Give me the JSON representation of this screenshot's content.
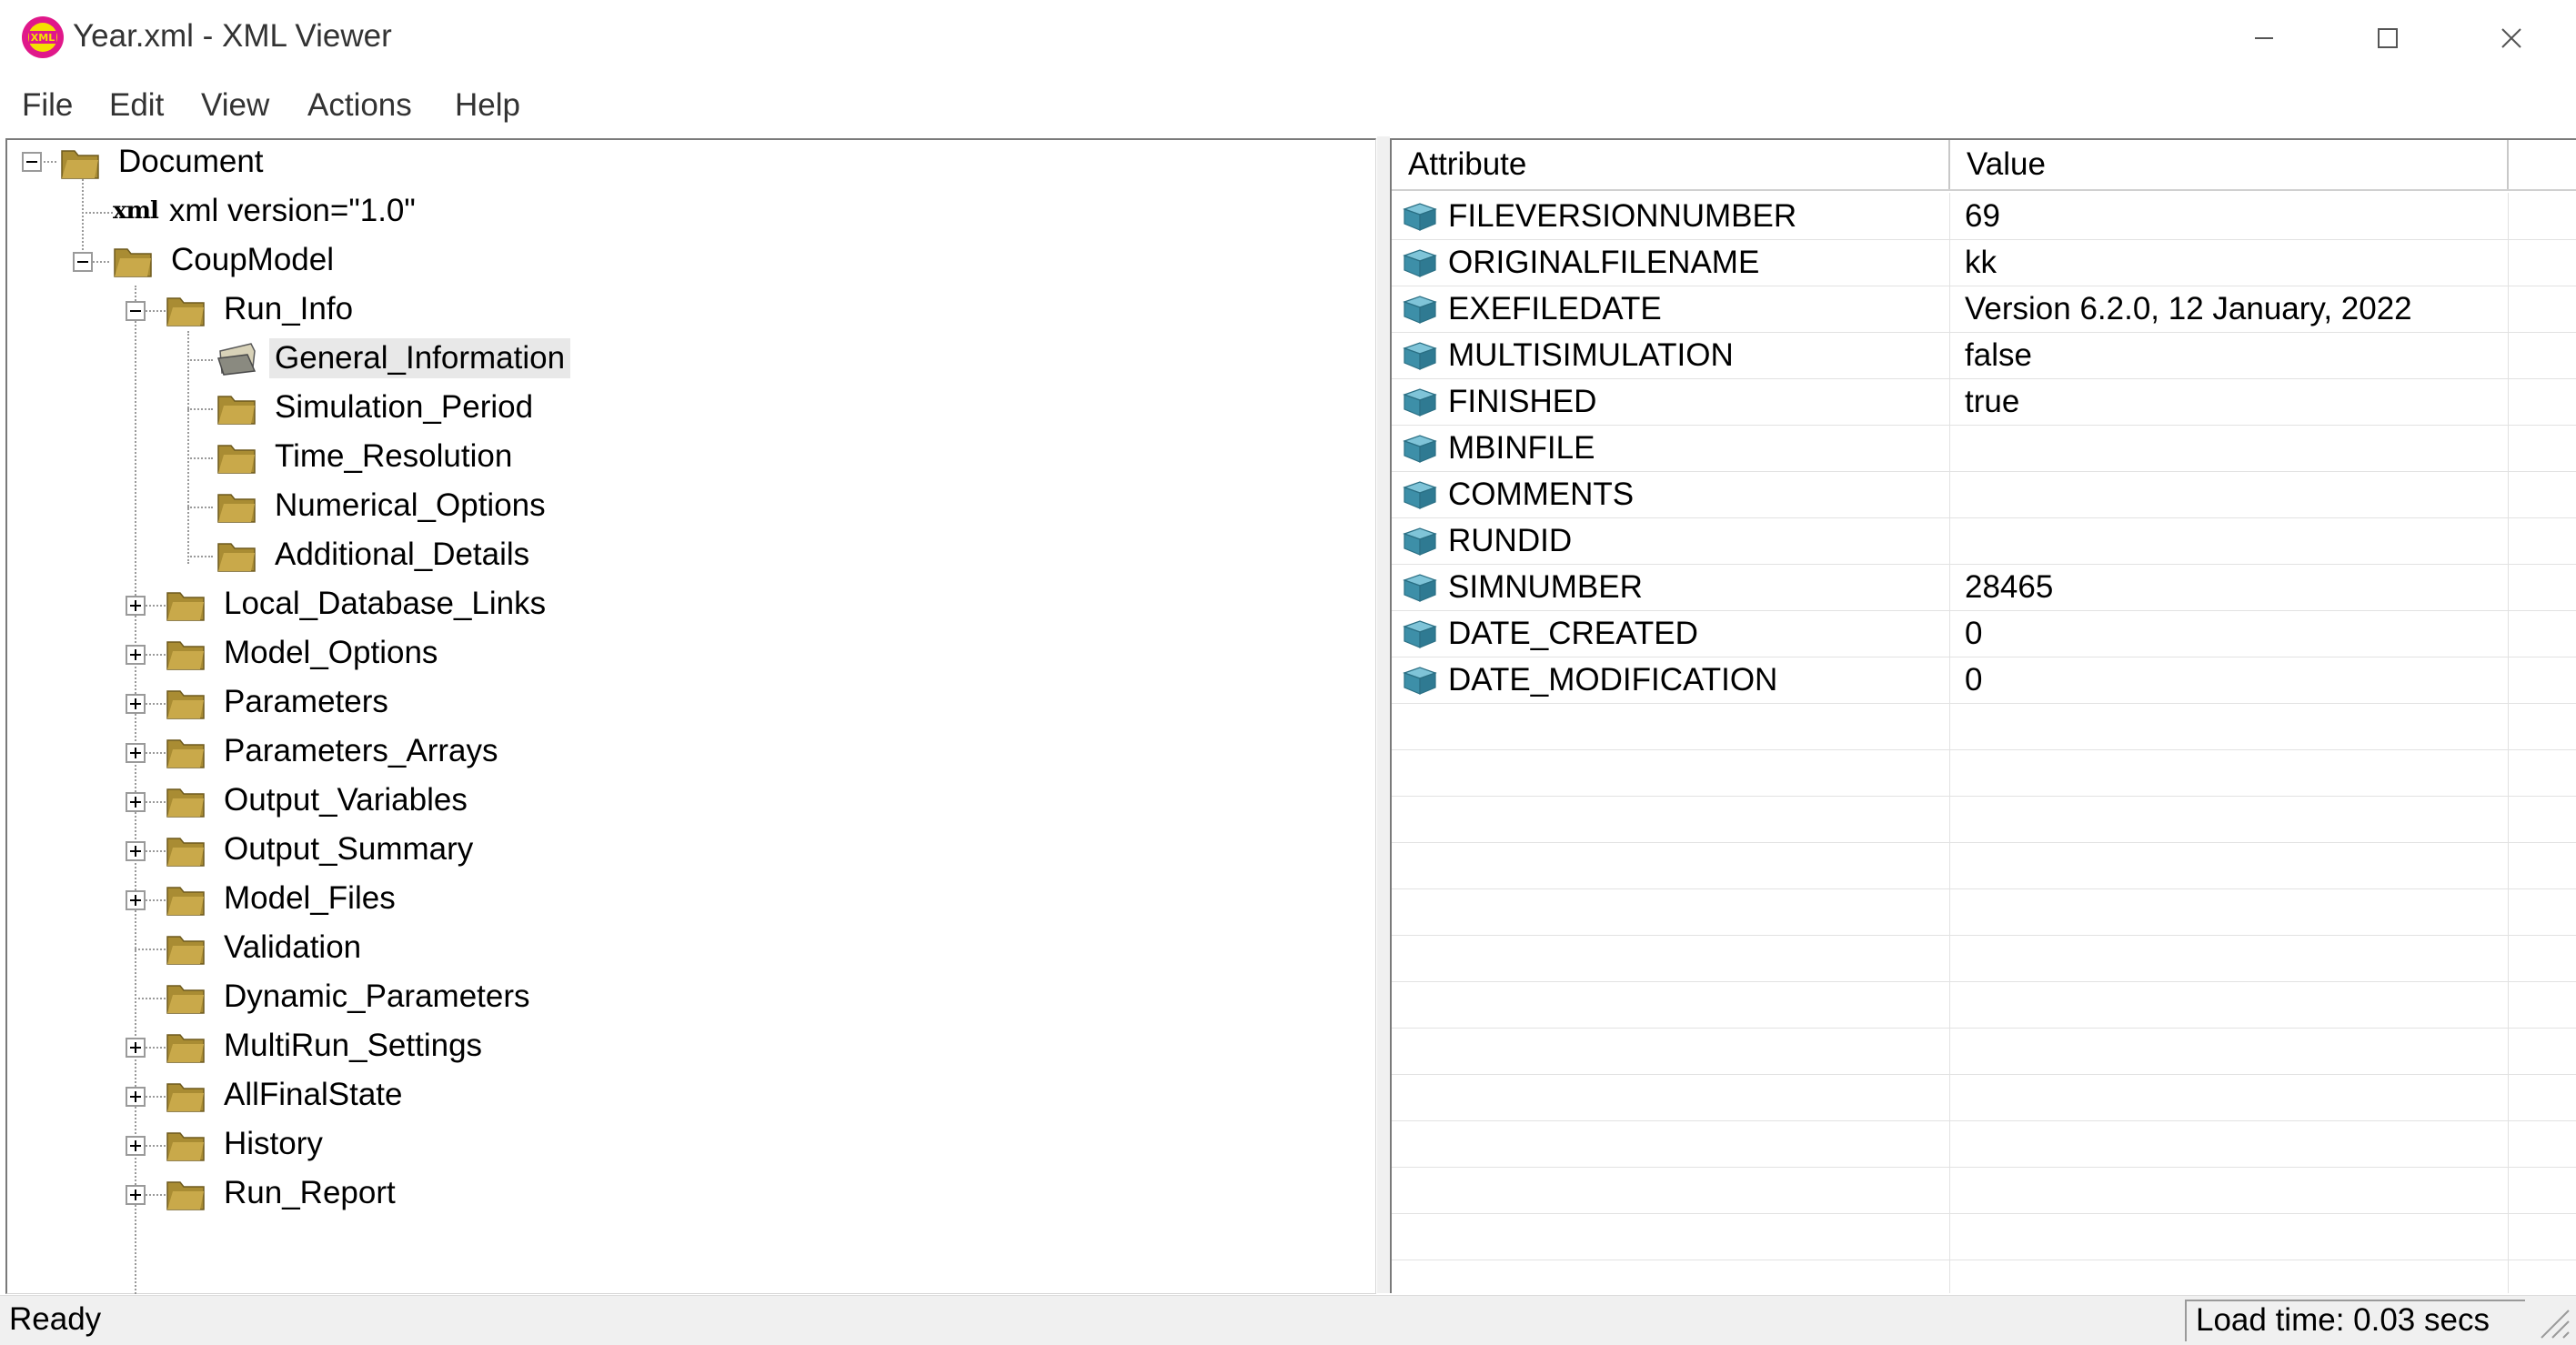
{
  "window": {
    "title": "Year.xml - XML Viewer",
    "app_icon": "xml-viewer-app-icon"
  },
  "menu": [
    "File",
    "Edit",
    "View",
    "Actions",
    "Help"
  ],
  "tree": {
    "root": "Document",
    "xml_decl_icon_text": "xml",
    "xml_decl": "xml version=\"1.0\"",
    "model": "CoupModel",
    "run_info": "Run_Info",
    "run_info_children": [
      "General_Information",
      "Simulation_Period",
      "Time_Resolution",
      "Numerical_Options",
      "Additional_Details"
    ],
    "selected": "General_Information",
    "model_children": [
      "Local_Database_Links",
      "Model_Options",
      "Parameters",
      "Parameters_Arrays",
      "Output_Variables",
      "Output_Summary",
      "Model_Files",
      "Validation",
      "Dynamic_Parameters",
      "MultiRun_Settings",
      "AllFinalState",
      "History",
      "Run_Report"
    ]
  },
  "grid": {
    "headers": {
      "attribute": "Attribute",
      "value": "Value"
    },
    "rows": [
      {
        "attribute": "FILEVERSIONNUMBER",
        "value": "69"
      },
      {
        "attribute": "ORIGINALFILENAME",
        "value": "kk"
      },
      {
        "attribute": "EXEFILEDATE",
        "value": "Version 6.2.0, 12 January, 2022"
      },
      {
        "attribute": "MULTISIMULATION",
        "value": "false"
      },
      {
        "attribute": "FINISHED",
        "value": "true"
      },
      {
        "attribute": "MBINFILE",
        "value": ""
      },
      {
        "attribute": "COMMENTS",
        "value": ""
      },
      {
        "attribute": "RUNDID",
        "value": ""
      },
      {
        "attribute": "SIMNUMBER",
        "value": "28465"
      },
      {
        "attribute": "DATE_CREATED",
        "value": "0"
      },
      {
        "attribute": "DATE_MODIFICATION",
        "value": "0"
      }
    ]
  },
  "status": {
    "ready": "Ready",
    "load_time": "Load time: 0.03 secs"
  },
  "colors": {
    "folder": "#a98c33",
    "attribute_icon": "#3d8fa8"
  }
}
